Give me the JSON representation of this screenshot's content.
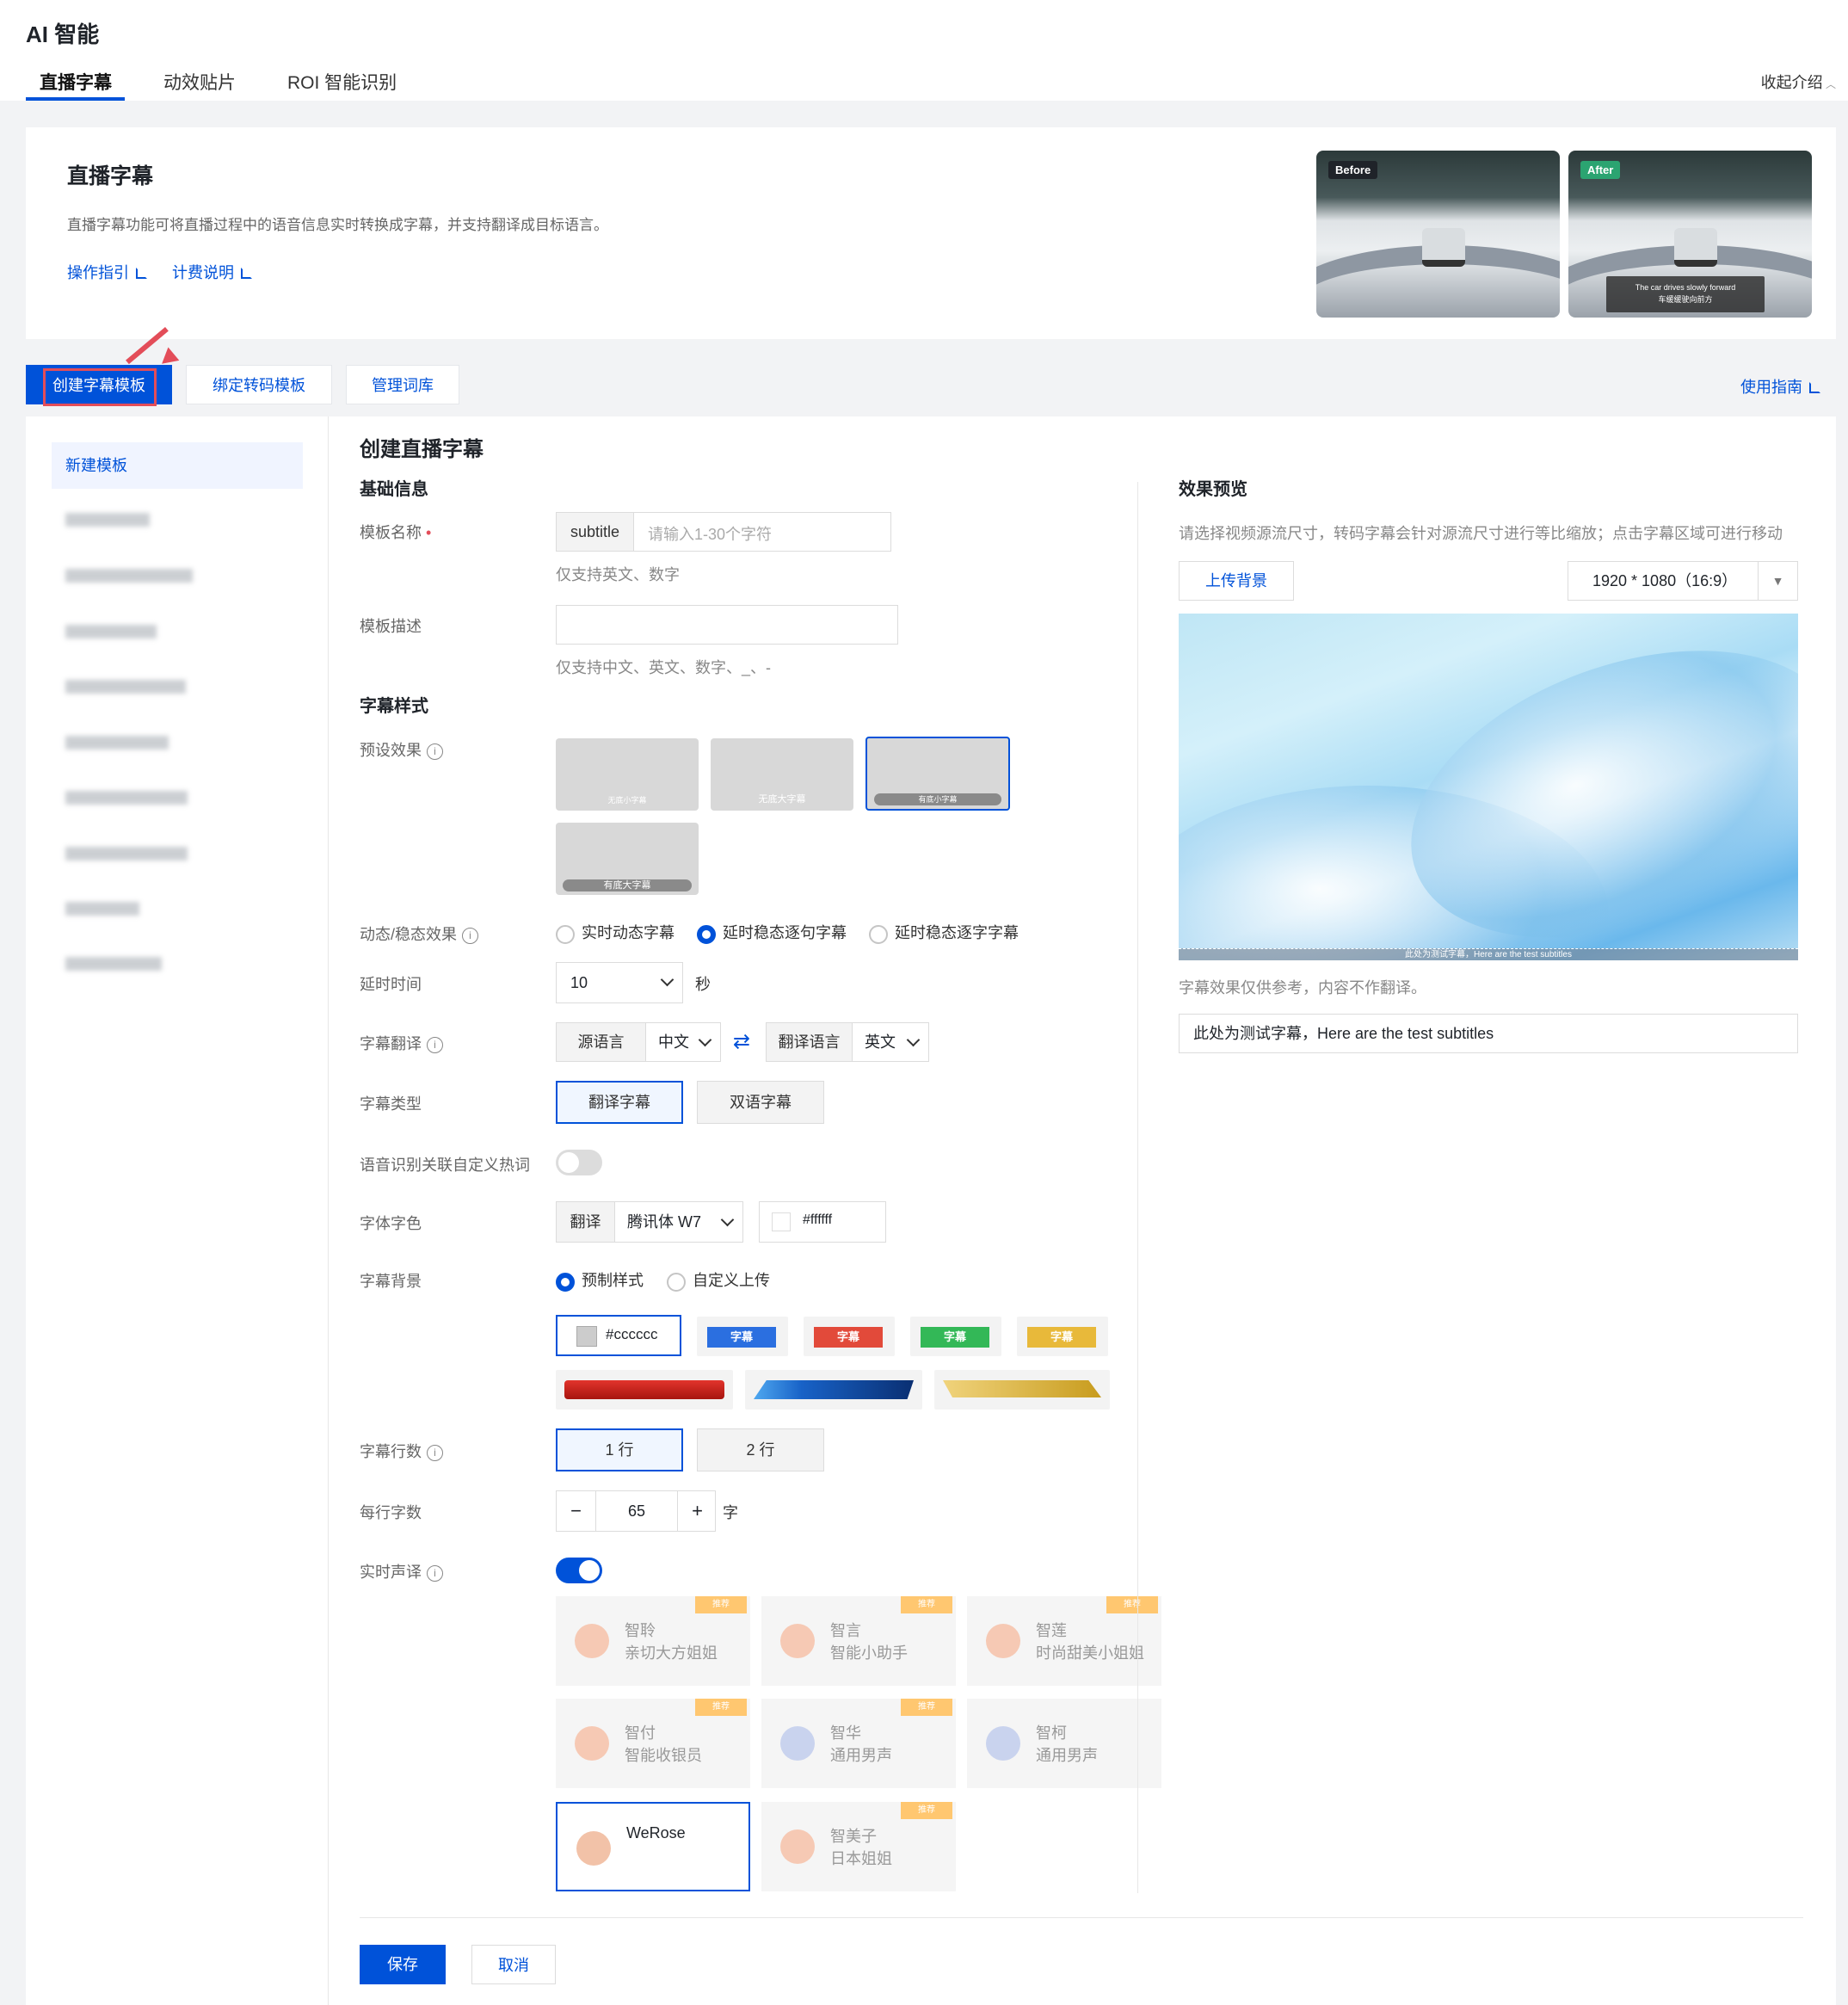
{
  "app": {
    "title": "AI 智能",
    "collapse_label": "收起介绍"
  },
  "tabs": [
    "直播字幕",
    "动效贴片",
    "ROI 智能识别"
  ],
  "intro": {
    "title": "直播字幕",
    "description": "直播字幕功能可将直播过程中的语音信息实时转换成字幕，并支持翻译成目标语言。",
    "links": [
      "操作指引",
      "计费说明"
    ],
    "before_label": "Before",
    "after_label": "After",
    "after_caption_en": "The car drives slowly forward",
    "after_caption_zh": "车缓缓驶向前方"
  },
  "subtabs": [
    "创建字幕模板",
    "绑定转码模板",
    "管理词库"
  ],
  "guide_link": "使用指南",
  "sidebar": {
    "active": "新建模板"
  },
  "form": {
    "page_title": "创建直播字幕",
    "basic_section": "基础信息",
    "name_label": "模板名称",
    "name_prefix": "subtitle",
    "name_placeholder": "请输入1-30个字符",
    "name_hint": "仅支持英文、数字",
    "desc_label": "模板描述",
    "desc_hint": "仅支持中文、英文、数字、_、-",
    "style_section": "字幕样式",
    "preset_label": "预设效果",
    "presets": [
      "无底小字幕",
      "无底大字幕",
      "有底小字幕",
      "有底大字幕"
    ],
    "mode_label": "动态/稳态效果",
    "modes": [
      "实时动态字幕",
      "延时稳态逐句字幕",
      "延时稳态逐字字幕"
    ],
    "delay_label": "延时时间",
    "delay_value": "10",
    "delay_unit": "秒",
    "translate_label": "字幕翻译",
    "source_lang_label": "源语言",
    "source_lang": "中文",
    "target_lang_label": "翻译语言",
    "target_lang": "英文",
    "type_label": "字幕类型",
    "types": [
      "翻译字幕",
      "双语字幕"
    ],
    "hotword_label": "语音识别关联自定义热词",
    "font_label": "字体字色",
    "font_prefix": "翻译",
    "font_name": "腾讯体 W7",
    "font_color": "#ffffff",
    "bg_label": "字幕背景",
    "bg_options": [
      "预制样式",
      "自定义上传"
    ],
    "bg_color": "#cccccc",
    "bg_chip_text": "字幕",
    "lines_label": "字幕行数",
    "lines": [
      "1 行",
      "2 行"
    ],
    "chars_label": "每行字数",
    "chars_value": "65",
    "chars_unit": "字",
    "minus": "−",
    "plus": "+",
    "tts_label": "实时声译",
    "voice_tag": "推荐",
    "voices": [
      {
        "name": "智聆",
        "desc": "亲切大方姐姐"
      },
      {
        "name": "智言",
        "desc": "智能小助手"
      },
      {
        "name": "智莲",
        "desc": "时尚甜美小姐姐"
      },
      {
        "name": "智付",
        "desc": "智能收银员"
      },
      {
        "name": "智华",
        "desc": "通用男声"
      },
      {
        "name": "智柯",
        "desc": "通用男声"
      },
      {
        "name": "WeRose",
        "desc": ""
      },
      {
        "name": "智美子",
        "desc": "日本姐姐"
      }
    ],
    "save": "保存",
    "cancel": "取消"
  },
  "preview": {
    "title": "效果预览",
    "hint": "请选择视频源流尺寸，转码字幕会针对源流尺寸进行等比缩放；点击字幕区域可进行移动",
    "upload": "上传背景",
    "resolution": "1920 * 1080（16:9）",
    "overlay_text": "此处为测试字幕，Here are the test subtitles",
    "note": "字幕效果仅供参考，内容不作翻译。",
    "sample_text": "此处为测试字幕，Here are the test subtitles"
  },
  "colors": {
    "brand": "#0052d9",
    "red": "#e34d59"
  }
}
